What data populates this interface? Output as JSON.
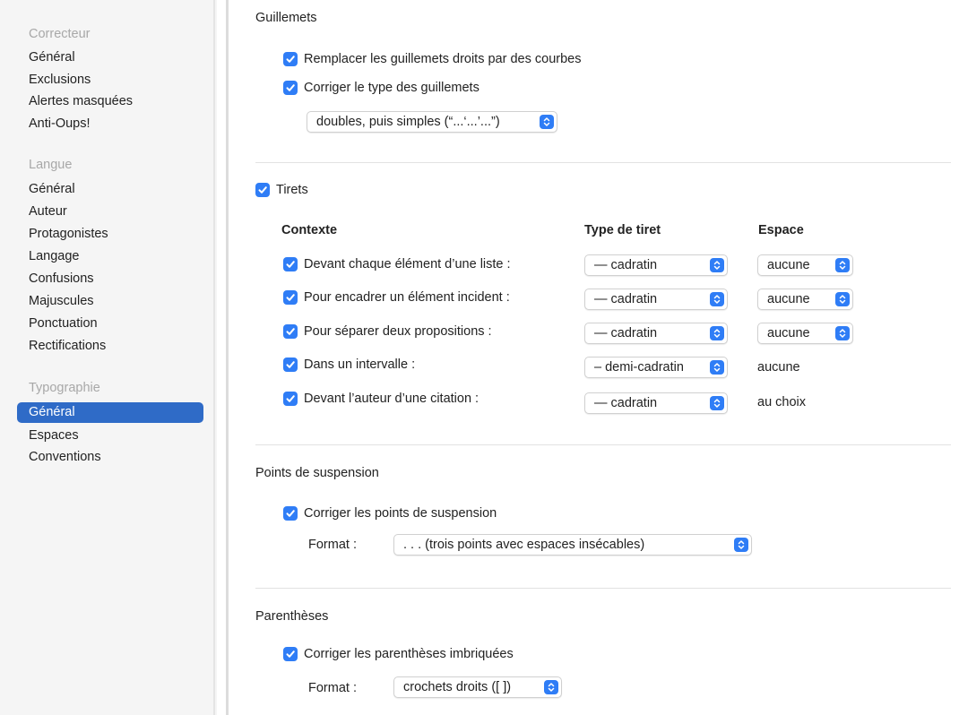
{
  "sidebar": {
    "groups": [
      {
        "title": "Correcteur",
        "items": [
          "Général",
          "Exclusions",
          "Alertes masquées",
          "Anti-Oups!"
        ]
      },
      {
        "title": "Langue",
        "items": [
          "Général",
          "Auteur",
          "Protagonistes",
          "Langage",
          "Confusions",
          "Majuscules",
          "Ponctuation",
          "Rectifications"
        ]
      },
      {
        "title": "Typographie",
        "items": [
          "Général",
          "Espaces",
          "Conventions"
        ]
      }
    ],
    "selected": "Typographie / Général"
  },
  "guillemets": {
    "title": "Guillemets",
    "replace_label": "Remplacer les guillemets droits par des courbes",
    "correct_label": "Corriger le type des guillemets",
    "type_value": "doubles, puis simples (“...‘...’...”)"
  },
  "tirets": {
    "title": "Tirets",
    "headers": {
      "context": "Contexte",
      "type": "Type de tiret",
      "space": "Espace"
    },
    "rows": [
      {
        "label": "Devant chaque élément d’une liste :",
        "type": "— cadratin",
        "space": "aucune",
        "space_popup": true
      },
      {
        "label": "Pour encadrer un élément incident :",
        "type": "— cadratin",
        "space": "aucune",
        "space_popup": true
      },
      {
        "label": "Pour séparer deux propositions :",
        "type": "— cadratin",
        "space": "aucune",
        "space_popup": true
      },
      {
        "label": "Dans un intervalle :",
        "type": "– demi-cadratin",
        "space": "aucune",
        "space_popup": false
      },
      {
        "label": "Devant l’auteur d’une citation :",
        "type": "— cadratin",
        "space": "au choix",
        "space_popup": false
      }
    ]
  },
  "suspension": {
    "title": "Points de suspension",
    "correct_label": "Corriger les points de suspension",
    "format_label": "Format :",
    "format_value": ". . . (trois points avec espaces insécables)"
  },
  "parentheses": {
    "title": "Parenthèses",
    "correct_label": "Corriger les parenthèses imbriquées",
    "format_label": "Format :",
    "format_value": "crochets droits ([ ])"
  },
  "colors": {
    "accent": "#2f7df6",
    "selection": "#2f6bc7"
  }
}
